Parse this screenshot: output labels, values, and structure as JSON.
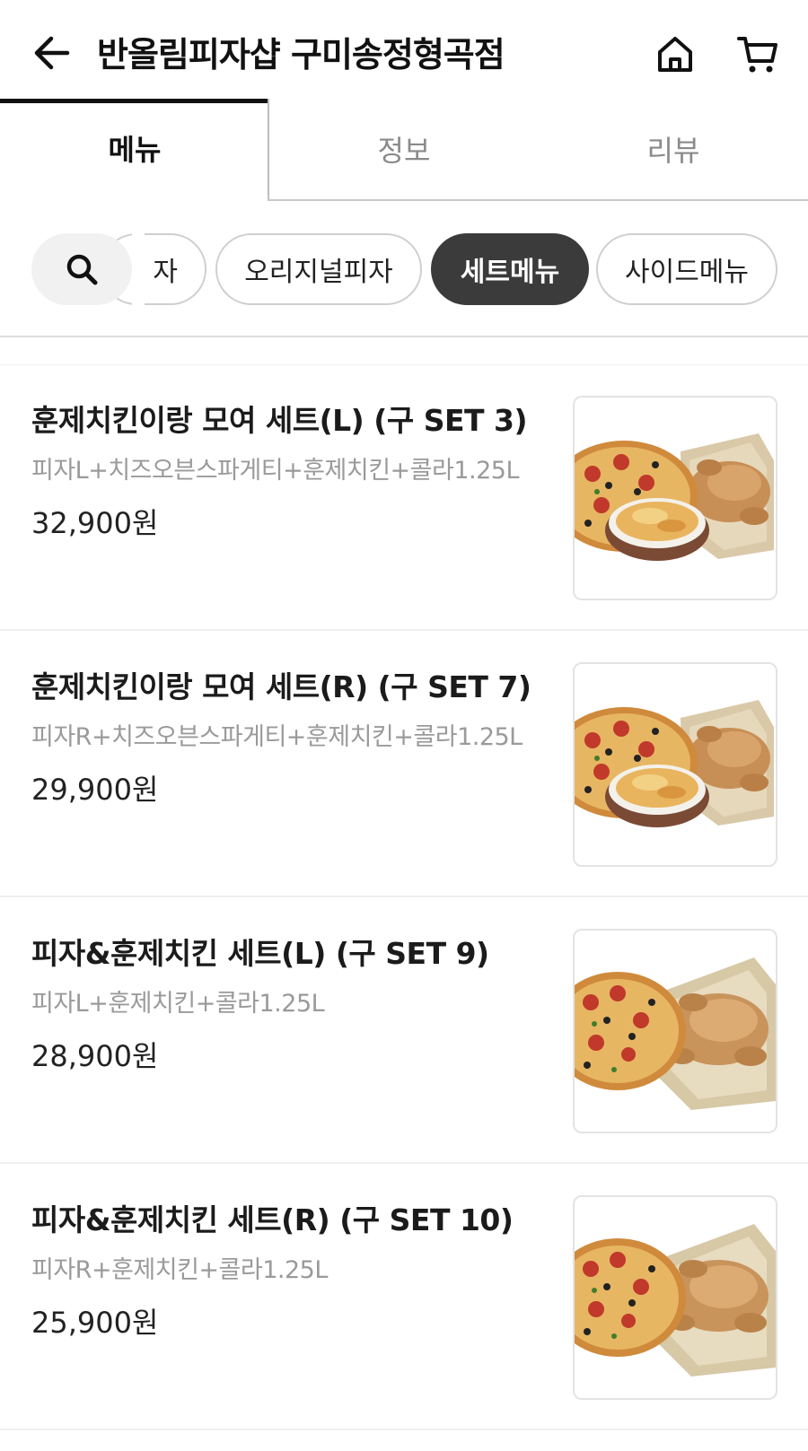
{
  "header": {
    "title": "반올림피자샵 구미송정형곡점",
    "back_icon": "arrow-left-icon",
    "home_icon": "home-icon",
    "cart_icon": "cart-icon"
  },
  "tabs": [
    {
      "label": "메뉴",
      "active": true
    },
    {
      "label": "정보",
      "active": false
    },
    {
      "label": "리뷰",
      "active": false
    }
  ],
  "categories": {
    "search_icon": "search-icon",
    "chips": [
      {
        "label": "피자",
        "visible_text": "자",
        "selected": false
      },
      {
        "label": "오리지널피자",
        "selected": false
      },
      {
        "label": "세트메뉴",
        "selected": true
      },
      {
        "label": "사이드메뉴",
        "selected": false
      }
    ]
  },
  "menu_items": [
    {
      "name": "훈제치킨이랑 모여 세트(L) (구 SET 3)",
      "description": "피자L+치즈오븐스파게티+훈제치킨+콜라1.25L",
      "price": "32,900원",
      "image": "pizza-spaghetti-chicken"
    },
    {
      "name": "훈제치킨이랑 모여 세트(R) (구 SET 7)",
      "description": "피자R+치즈오븐스파게티+훈제치킨+콜라1.25L",
      "price": "29,900원",
      "image": "pizza-spaghetti-chicken"
    },
    {
      "name": "피자&훈제치킨 세트(L) (구 SET 9)",
      "description": "피자L+훈제치킨+콜라1.25L",
      "price": "28,900원",
      "image": "pizza-chicken"
    },
    {
      "name": "피자&훈제치킨 세트(R) (구 SET 10)",
      "description": "피자R+훈제치킨+콜라1.25L",
      "price": "25,900원",
      "image": "pizza-chicken"
    }
  ],
  "colors": {
    "accent_dark": "#3b3b3b",
    "text_primary": "#111111",
    "text_muted": "#9a9a9a"
  }
}
